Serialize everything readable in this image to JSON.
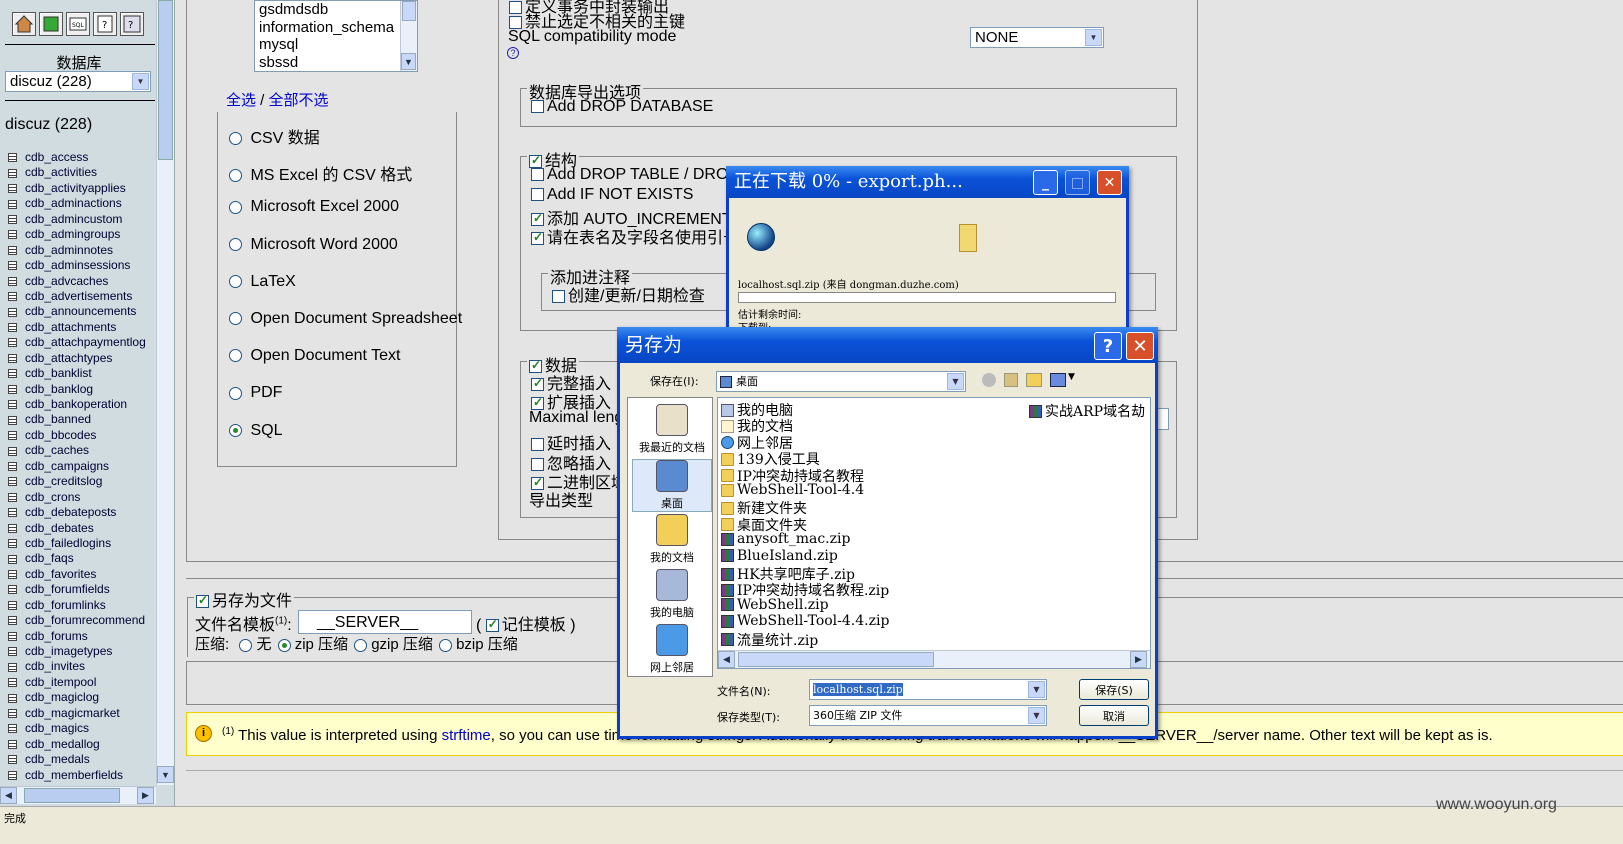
{
  "nav": {
    "db_label": "数据库",
    "db_select": "discuz (228)",
    "db_heading": "discuz (228)",
    "tables": [
      "cdb_access",
      "cdb_activities",
      "cdb_activityapplies",
      "cdb_adminactions",
      "cdb_admincustom",
      "cdb_admingroups",
      "cdb_adminnotes",
      "cdb_adminsessions",
      "cdb_advcaches",
      "cdb_advertisements",
      "cdb_announcements",
      "cdb_attachments",
      "cdb_attachpaymentlog",
      "cdb_attachtypes",
      "cdb_banklist",
      "cdb_banklog",
      "cdb_bankoperation",
      "cdb_banned",
      "cdb_bbcodes",
      "cdb_caches",
      "cdb_campaigns",
      "cdb_creditslog",
      "cdb_crons",
      "cdb_debateposts",
      "cdb_debates",
      "cdb_failedlogins",
      "cdb_faqs",
      "cdb_favorites",
      "cdb_forumfields",
      "cdb_forumlinks",
      "cdb_forumrecommend",
      "cdb_forums",
      "cdb_imagetypes",
      "cdb_invites",
      "cdb_itempool",
      "cdb_magiclog",
      "cdb_magicmarket",
      "cdb_magics",
      "cdb_medallog",
      "cdb_medals",
      "cdb_memberfields"
    ]
  },
  "export": {
    "db_list": [
      "gsdmdsdb",
      "information_schema",
      "mysql",
      "sbssd"
    ],
    "select_all": "全选",
    "sep": " / ",
    "deselect_all": "全部不选",
    "formats": [
      "CSV 数据",
      "MS Excel 的 CSV 格式",
      "Microsoft Excel 2000",
      "Microsoft Word 2000",
      "LaTeX",
      "Open Document Spreadsheet",
      "Open Document Text",
      "PDF",
      "SQL"
    ],
    "selected_format": "SQL"
  },
  "sql_opts": {
    "top_line1": "定义事务中封装输出",
    "top_line2": "禁止选定不相关的主键",
    "compat_label": "SQL compatibility mode",
    "compat_value": "NONE",
    "help_icon": "?",
    "db_opts_legend": "数据库导出选项",
    "add_drop_db": "Add DROP DATABASE",
    "structure": "结构",
    "add_drop_table": "Add DROP TABLE / DROP VIEW",
    "if_not_exists": "Add IF NOT EXISTS",
    "auto_inc": "添加 AUTO_INCREMENT 值",
    "quote": "请在表名及字段名使用引号",
    "comments_legend": "添加进注释",
    "comments_opt": "创建/更新/日期检查",
    "data": "数据",
    "complete_insert": "完整插入",
    "extended_insert": "扩展插入",
    "max_length": "Maximal length of created query",
    "delayed": "延时插入",
    "ignore": "忽略插入",
    "binary": "二进制区域使用十六进制",
    "export_type": "导出类型"
  },
  "save": {
    "legend": "另存为文件",
    "template_label": "文件名模板",
    "template_sup": "(1)",
    "template_colon": ":",
    "template_value": "__SERVER__",
    "remember_open": "(",
    "remember": "记住模板",
    "remember_close": ")",
    "compress_label": "压缩:",
    "compress_opts": [
      "无",
      "zip 压缩",
      "gzip 压缩",
      "bzip 压缩"
    ]
  },
  "footnote": {
    "sup": "(1)",
    "pre": "This value is interpreted using ",
    "link": "strftime",
    "post": ", so you can use time formatting strings. Additionally the following transformations will happen: __SERVER__/server name. Other text will be kept as is."
  },
  "download": {
    "title": "正在下载 0% - export.ph...",
    "file_line": "localhost.sql.zip (来自 dongman.duzhe.com)",
    "remaining": "估计剩余时间:",
    "cut_line": "下载到:",
    "progress": 0
  },
  "saveas": {
    "title": "另存为",
    "save_in_label": "保存在(I):",
    "save_in_value": "桌面",
    "places": [
      "我最近的文档",
      "桌面",
      "我的文档",
      "我的电脑",
      "网上邻居"
    ],
    "files": [
      {
        "name": "我的电脑",
        "icon": "pc"
      },
      {
        "name": "我的文档",
        "icon": "doc"
      },
      {
        "name": "网上邻居",
        "icon": "net"
      },
      {
        "name": "139入侵工具",
        "icon": "folder"
      },
      {
        "name": "IP冲突劫持域名教程",
        "icon": "folder"
      },
      {
        "name": "WebShell-Tool-4.4",
        "icon": "folder"
      },
      {
        "name": "新建文件夹",
        "icon": "folder"
      },
      {
        "name": "桌面文件夹",
        "icon": "folder"
      },
      {
        "name": "anysoft_mac.zip",
        "icon": "zip"
      },
      {
        "name": "BlueIsland.zip",
        "icon": "zip"
      },
      {
        "name": "HK共享吧库子.zip",
        "icon": "zip"
      },
      {
        "name": "IP冲突劫持域名教程.zip",
        "icon": "zip"
      },
      {
        "name": "WebShell.zip",
        "icon": "zip"
      },
      {
        "name": "WebShell-Tool-4.4.zip",
        "icon": "zip"
      },
      {
        "name": "流量统计.zip",
        "icon": "zip"
      }
    ],
    "file_col2": "实战ARP域名劫",
    "filename_label": "文件名(N):",
    "filename_value": "localhost.sql.zip",
    "filetype_label": "保存类型(T):",
    "filetype_value": "360压缩 ZIP 文件",
    "save_btn": "保存(S)",
    "cancel_btn": "取消"
  },
  "watermark": "www.wooyun.org",
  "status_text": "完成",
  "colors": {
    "accent": "#0a52d8",
    "close": "#d8502a",
    "footnote_bg": "#ffffcc"
  }
}
